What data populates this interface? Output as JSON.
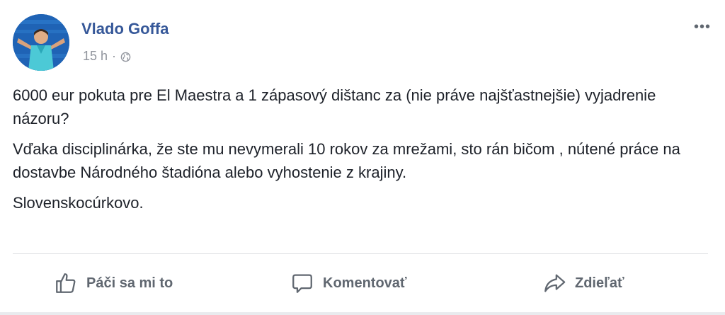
{
  "post": {
    "author": "Vlado Goffa",
    "time": "15 h",
    "separator": "·",
    "visibility_icon": "globe-icon",
    "more_icon": "more-options-icon",
    "more_label": "•••",
    "paragraphs": [
      "6000 eur pokuta pre El Maestra a 1 zápasový dištanc za (nie práve najšťastnejšie) vyjadrenie názoru?",
      "Vďaka disciplinárka, že ste mu nevymerali 10 rokov za mrežami, sto rán bičom , nútené práce na dostavbe Národného štadióna alebo vyhostenie z krajiny.",
      "Slovenskocúrkovo."
    ]
  },
  "actions": {
    "like": {
      "label": "Páči sa mi to",
      "icon": "thumbs-up-icon"
    },
    "comment": {
      "label": "Komentovať",
      "icon": "comment-bubble-icon"
    },
    "share": {
      "label": "Zdieľať",
      "icon": "share-arrow-icon"
    }
  },
  "colors": {
    "author_link": "#365899",
    "meta_text": "#90949c",
    "body_text": "#1d2129",
    "action_text": "#606770",
    "divider": "#dddfe2"
  }
}
